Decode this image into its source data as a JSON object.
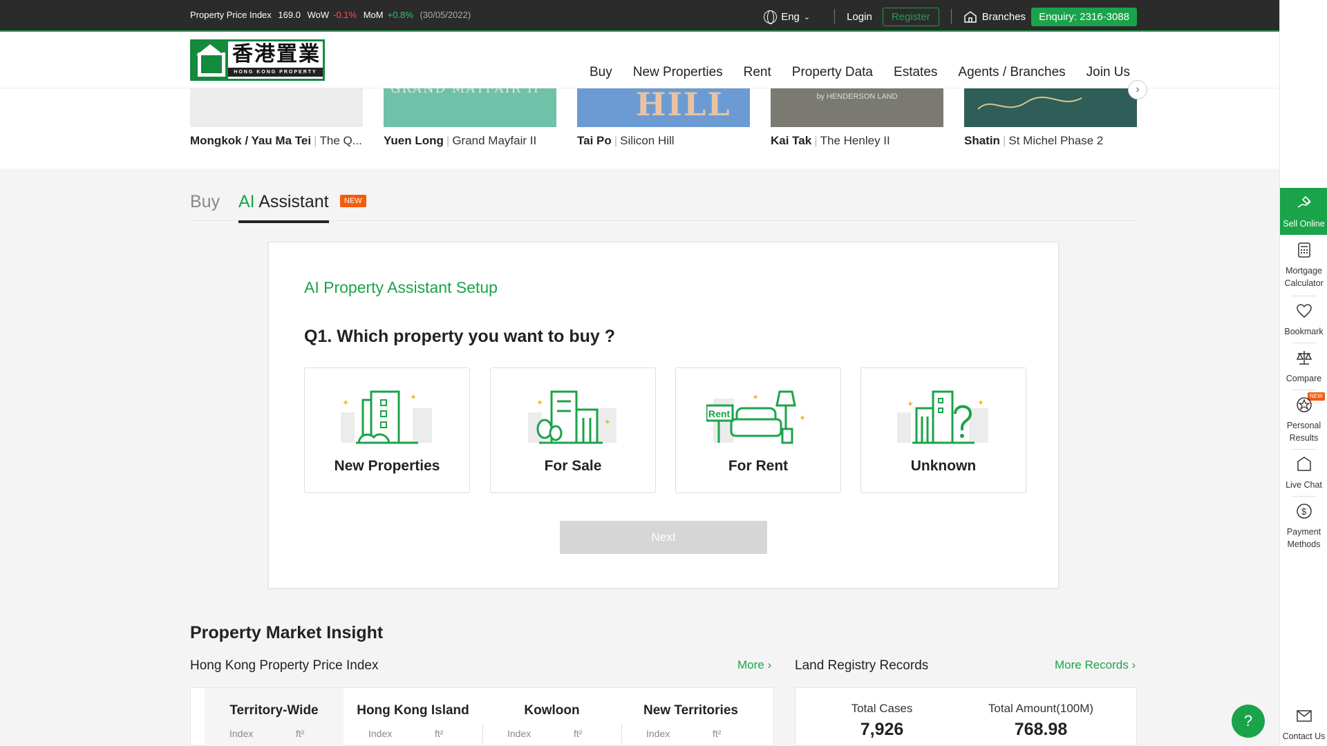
{
  "topbar": {
    "ppi_label": "Property Price Index",
    "ppi_value": "169.0",
    "wow_label": "WoW",
    "wow_value": "-0.1%",
    "mom_label": "MoM",
    "mom_value": "+0.8%",
    "date": "(30/05/2022)",
    "lang": "Eng",
    "login": "Login",
    "register": "Register",
    "branches": "Branches",
    "enquiry": "Enquiry: 2316-3088",
    "colors": {
      "bar": "#2b2b2b",
      "accent": "#1aa34a",
      "negative": "#ff4d4d",
      "positive": "#38c172"
    }
  },
  "header": {
    "logo_cn": "香港置業",
    "logo_en": "HONG KONG PROPERTY",
    "nav": [
      "Buy",
      "New Properties",
      "Rent",
      "Property Data",
      "Estates",
      "Agents / Branches",
      "Join Us"
    ]
  },
  "carousel": {
    "cards": [
      {
        "district": "Mongkok / Yau Ma Tei",
        "name": "The Q...",
        "img_text": ""
      },
      {
        "district": "Yuen Long",
        "name": "Grand Mayfair II",
        "img_text": "GRAND MAYFAIR II"
      },
      {
        "district": "Tai Po",
        "name": "Silicon Hill",
        "img_text": "HILL"
      },
      {
        "district": "Kai Tak",
        "name": "The Henley II",
        "img_text": "by HENDERSON LAND"
      },
      {
        "district": "Shatin",
        "name": "St Michel Phase 2",
        "img_text": ""
      }
    ]
  },
  "tabs": {
    "buy": "Buy",
    "ai_prefix": "AI",
    "ai_rest": " Assistant",
    "badge": "NEW"
  },
  "setup": {
    "title": "AI Property Assistant Setup",
    "question": "Q1. Which property you want to buy ?",
    "options": [
      "New Properties",
      "For Sale",
      "For Rent",
      "Unknown"
    ],
    "rent_sign": "Rent",
    "next": "Next"
  },
  "insight": {
    "title": "Property Market Insight",
    "ppi_title": "Hong Kong Property Price Index",
    "more": "More",
    "lr_title": "Land Registry Records",
    "more_records": "More Records",
    "regions": [
      {
        "name": "Territory-Wide",
        "index": "Index",
        "unit": "ft²"
      },
      {
        "name": "Hong Kong Island",
        "index": "Index",
        "unit": "ft²"
      },
      {
        "name": "Kowloon",
        "index": "Index",
        "unit": "ft²"
      },
      {
        "name": "New Territories",
        "index": "Index",
        "unit": "ft²"
      }
    ],
    "total_cases_label": "Total Cases",
    "total_cases": "7,926",
    "total_amount_label": "Total Amount(100M)",
    "total_amount": "768.98"
  },
  "sidebar": {
    "items": [
      {
        "label": "Sell Online",
        "icon": "sell-hand-icon"
      },
      {
        "label": "Mortgage Calculator",
        "icon": "calculator-icon"
      },
      {
        "label": "Bookmark",
        "icon": "heart-icon"
      },
      {
        "label": "Compare",
        "icon": "scale-icon"
      },
      {
        "label": "Personal Results",
        "icon": "star-icon",
        "badge": "NEW"
      },
      {
        "label": "Live Chat",
        "icon": "chat-icon"
      },
      {
        "label": "Payment Methods",
        "icon": "dollar-icon"
      },
      {
        "label": "Contact Us",
        "icon": "mail-icon"
      }
    ],
    "help": "?"
  }
}
